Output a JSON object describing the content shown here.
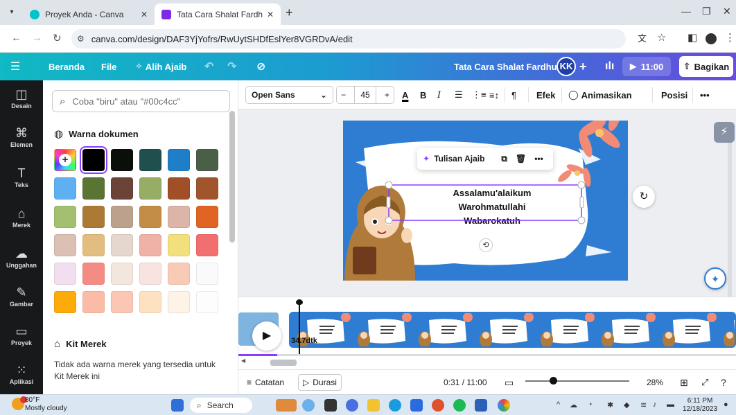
{
  "browser": {
    "tabs": [
      {
        "title": "Proyek Anda - Canva",
        "active": false
      },
      {
        "title": "Tata Cara Shalat Fardhu - Video",
        "active": true
      }
    ],
    "url": "canva.com/design/DAF3YjYofrs/RwUytSHDfEslYer8VGRDvA/edit"
  },
  "header": {
    "menu_icon": "menu-icon",
    "home": "Beranda",
    "file": "File",
    "magic_switch": "Alih Ajaib",
    "doc_title": "Tata Cara Shalat Fardhu",
    "avatar": "KK",
    "add": "+",
    "play_time": "11:00",
    "share": "Bagikan",
    "brand_color": "#7d2ae8"
  },
  "rail": [
    {
      "icon": "design-icon",
      "label": "Desain"
    },
    {
      "icon": "elements-icon",
      "label": "Elemen"
    },
    {
      "icon": "text-icon",
      "label": "Teks"
    },
    {
      "icon": "brand-icon",
      "label": "Merek"
    },
    {
      "icon": "upload-icon",
      "label": "Unggahan"
    },
    {
      "icon": "draw-icon",
      "label": "Gambar"
    },
    {
      "icon": "project-icon",
      "label": "Proyek"
    },
    {
      "icon": "apps-icon",
      "label": "Aplikasi"
    }
  ],
  "panel": {
    "search_placeholder": "Coba \"biru\" atau \"#00c4cc\"",
    "doc_colors_title": "Warna dokumen",
    "swatches": [
      [
        "#000000",
        "#0b0f0a",
        "#1f4f4f",
        "#1f7ec8",
        "#4a5e48"
      ],
      [
        "#5fb0f3",
        "#5a7434",
        "#6b4437",
        "#97ad65",
        "#a14f26",
        "#a0552d"
      ],
      [
        "#a3c070",
        "#ad7a35",
        "#bca28d",
        "#c48d47",
        "#dcb5a8",
        "#e06423"
      ],
      [
        "#dbc0b3",
        "#e3bd80",
        "#e5d7cd",
        "#eeb2a6",
        "#f2e07c",
        "#f36f6f"
      ],
      [
        "#f1dff0",
        "#f48c84",
        "#f3e6dc",
        "#f7e4e1",
        "#f9cbb6",
        "#fafafa"
      ],
      [
        "#fdab0b",
        "#fbbca7",
        "#fbc6b4",
        "#fde1c0",
        "#fdf3e6",
        "#fdfdfd"
      ]
    ],
    "brand_kit_title": "Kit Merek",
    "brand_kit_text": "Tidak ada warna merek yang tersedia untuk Kit Merek ini"
  },
  "toolbar": {
    "font": "Open Sans",
    "font_size": "45",
    "minus": "−",
    "plus": "+",
    "effects": "Efek",
    "animate": "Animasikan",
    "position": "Posisi",
    "more": "•••"
  },
  "canvas": {
    "text_lines": [
      "Assalamu'alaikum",
      "Warohmatullahi",
      "Wabarokatuh"
    ],
    "magic_write": "Tulisan Ajaib",
    "slide_bg": "#2f7dd3"
  },
  "timeline": {
    "duration_label": "34.7dtk",
    "frames": 8
  },
  "bottom": {
    "notes": "Catatan",
    "duration": "Durasi",
    "time": "0:31 / 11:00",
    "zoom": "28%",
    "zoom_fraction": 0.28
  },
  "taskbar": {
    "temp": "80°F",
    "weather": "Mostly cloudy",
    "search": "Search",
    "time": "6:11 PM",
    "date": "12/18/2023"
  }
}
